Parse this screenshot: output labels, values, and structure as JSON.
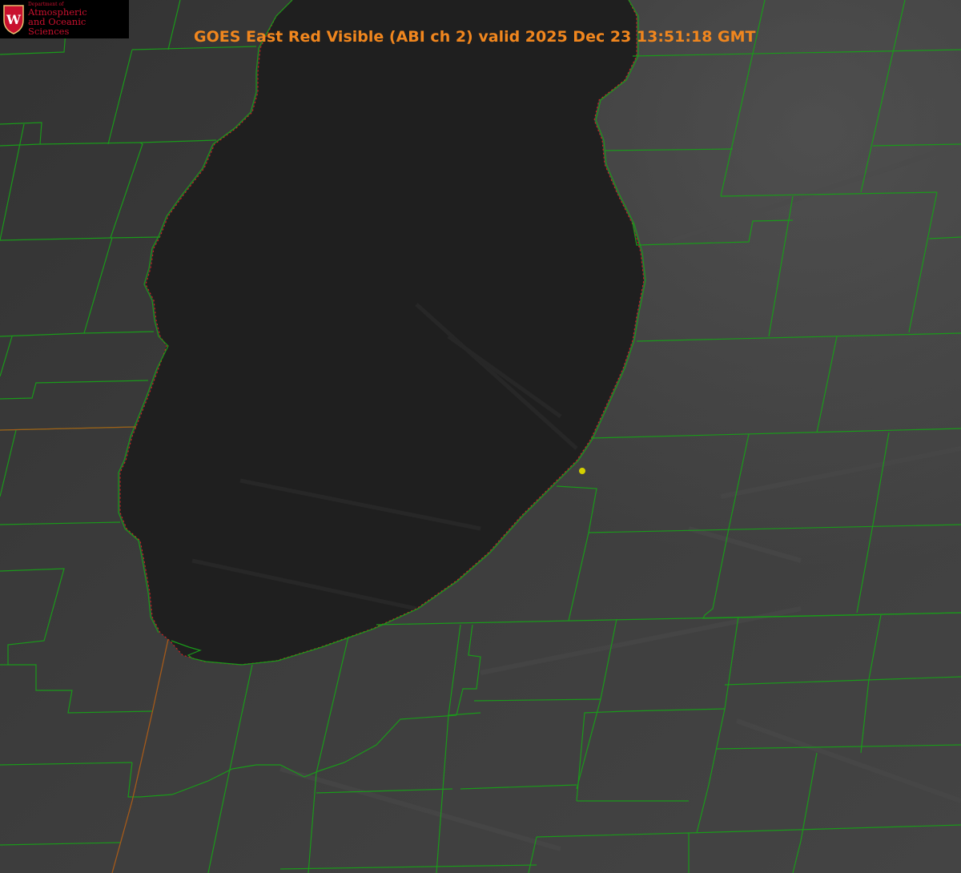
{
  "image": {
    "title": "GOES East Red Visible (ABI ch 2) valid 2025 Dec 23 13:51:18 GMT"
  },
  "logo": {
    "dept_line": "Department of",
    "line1": "Atmospheric",
    "line2": "and Oceanic Sciences",
    "crest_letter": "W",
    "color": "#c8102e"
  },
  "map": {
    "land_color": "#3b3b3b",
    "lake_color": "#1f1f1f",
    "county_line_color": "#1a9a1a",
    "shoreline_color": "#d02020",
    "state_line_color": "#b03a1a",
    "marker_color": "#d4d000"
  }
}
